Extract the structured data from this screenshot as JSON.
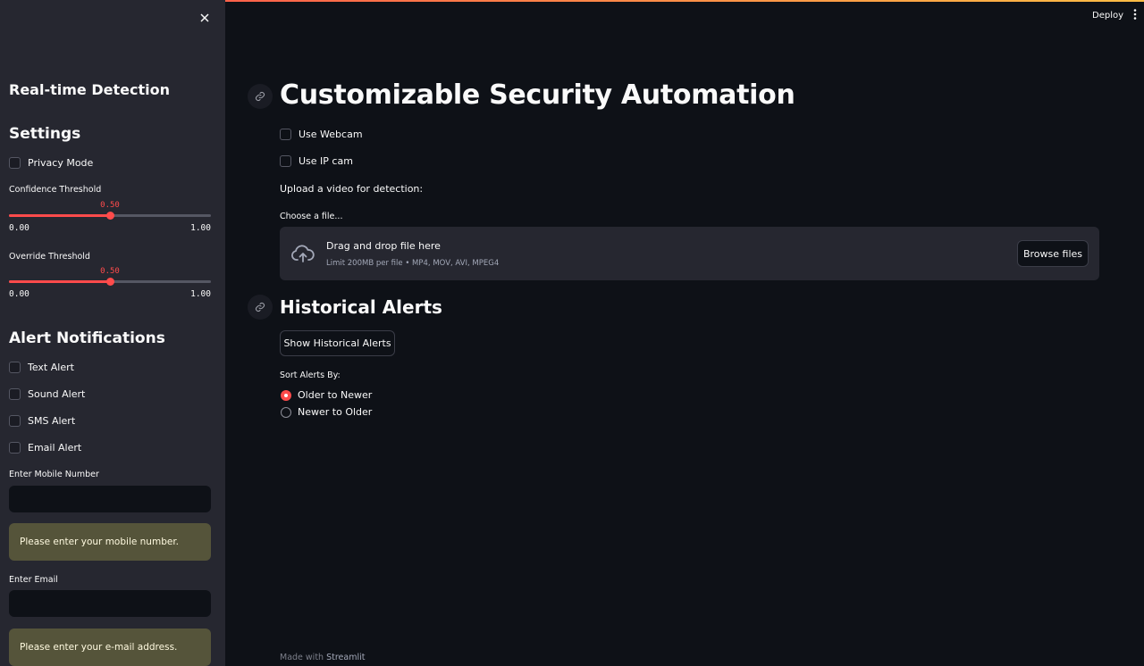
{
  "header": {
    "deploy_label": "Deploy",
    "menu_icon": "kebab-menu-icon"
  },
  "sidebar": {
    "close_icon": "close-icon",
    "title": "Real-time Detection",
    "settings_heading": "Settings",
    "privacy_mode_label": "Privacy Mode",
    "confidence": {
      "label": "Confidence Threshold",
      "value": "0.50",
      "fraction": 0.5,
      "min": "0.00",
      "max": "1.00"
    },
    "override": {
      "label": "Override Threshold",
      "value": "0.50",
      "fraction": 0.5,
      "min": "0.00",
      "max": "1.00"
    },
    "alerts_heading": "Alert Notifications",
    "alerts": [
      {
        "label": "Text Alert",
        "checked": false
      },
      {
        "label": "Sound Alert",
        "checked": false
      },
      {
        "label": "SMS Alert",
        "checked": false
      },
      {
        "label": "Email Alert",
        "checked": false
      }
    ],
    "mobile": {
      "label": "Enter Mobile Number",
      "value": "",
      "warning": "Please enter your mobile number."
    },
    "email": {
      "label": "Enter Email",
      "value": "",
      "warning": "Please enter your e-mail address."
    }
  },
  "main": {
    "title": "Customizable Security Automation",
    "use_webcam_label": "Use Webcam",
    "use_ipcam_label": "Use IP cam",
    "upload_prompt": "Upload a video for detection:",
    "uploader": {
      "label": "Choose a file...",
      "dropzone_title": "Drag and drop file here",
      "dropzone_sub": "Limit 200MB per file • MP4, MOV, AVI, MPEG4",
      "browse_label": "Browse files",
      "icon": "cloud-upload-icon"
    },
    "history_heading": "Historical Alerts",
    "show_history_label": "Show Historical Alerts",
    "sort_label": "Sort Alerts By:",
    "sort_options": [
      {
        "label": "Older to Newer",
        "selected": true
      },
      {
        "label": "Newer to Older",
        "selected": false
      }
    ]
  },
  "footer": {
    "prefix": "Made with",
    "brand": "Streamlit"
  },
  "colors": {
    "accent": "#ff4b4b",
    "background": "#0e1117",
    "sidebar": "#262730",
    "warning": "#55543a"
  }
}
